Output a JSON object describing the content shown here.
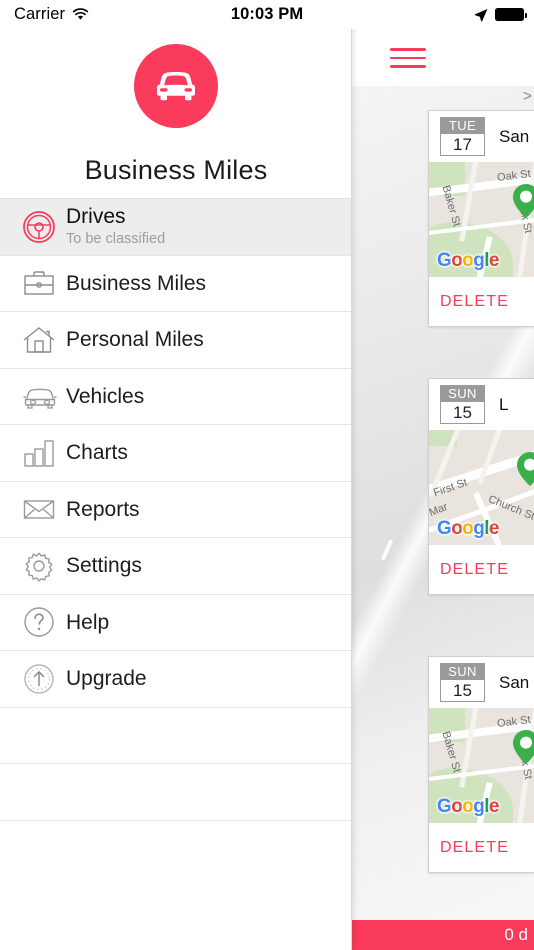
{
  "status_bar": {
    "carrier": "Carrier",
    "wifi_icon": "wifi-icon",
    "time": "10:03 PM",
    "location_icon": "location-arrow-icon",
    "battery_icon": "battery-full-icon"
  },
  "drawer": {
    "logo_icon": "car-front-icon",
    "brand_color": "#FA3B5C",
    "app_title": "Business Miles",
    "items": [
      {
        "id": "drives",
        "label": "Drives",
        "subtitle": "To be classified",
        "icon": "steering-wheel-icon",
        "active": true
      },
      {
        "id": "business-miles",
        "label": "Business Miles",
        "subtitle": "",
        "icon": "briefcase-icon",
        "active": false
      },
      {
        "id": "personal-miles",
        "label": "Personal Miles",
        "subtitle": "",
        "icon": "house-icon",
        "active": false
      },
      {
        "id": "vehicles",
        "label": "Vehicles",
        "subtitle": "",
        "icon": "car-icon",
        "active": false
      },
      {
        "id": "charts",
        "label": "Charts",
        "subtitle": "",
        "icon": "bar-chart-icon",
        "active": false
      },
      {
        "id": "reports",
        "label": "Reports",
        "subtitle": "",
        "icon": "envelope-icon",
        "active": false
      },
      {
        "id": "settings",
        "label": "Settings",
        "subtitle": "",
        "icon": "gear-icon",
        "active": false
      },
      {
        "id": "help",
        "label": "Help",
        "subtitle": "",
        "icon": "question-circle-icon",
        "active": false
      },
      {
        "id": "upgrade",
        "label": "Upgrade",
        "subtitle": "",
        "icon": "upgrade-arrow-icon",
        "active": false
      }
    ]
  },
  "content": {
    "menu_button_icon": "hamburger-menu-icon",
    "expand_caret": ">",
    "cards": [
      {
        "day_of_week": "TUE",
        "day_number": "17",
        "place": "San",
        "map": {
          "provider_logo": "Google",
          "pin_icon": "map-pin-icon",
          "street_labels": [
            "Oak St",
            "Baker St",
            "ck St"
          ]
        },
        "delete_label": "DELETE"
      },
      {
        "day_of_week": "SUN",
        "day_number": "15",
        "place": "L",
        "map": {
          "provider_logo": "Google",
          "pin_icon": "map-pin-icon",
          "street_labels": [
            "First St",
            "Church St",
            "Mar"
          ]
        },
        "delete_label": "DELETE"
      },
      {
        "day_of_week": "SUN",
        "day_number": "15",
        "place": "San",
        "map": {
          "provider_logo": "Google",
          "pin_icon": "map-pin-icon",
          "street_labels": [
            "Oak St",
            "Baker St",
            "ck St"
          ]
        },
        "delete_label": "DELETE"
      }
    ],
    "bottom_bar": {
      "text": "0 d",
      "color": "#FA3B5C"
    }
  }
}
